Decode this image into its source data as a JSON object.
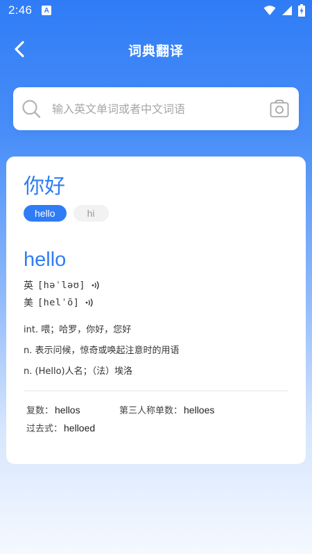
{
  "status_bar": {
    "time": "2:46",
    "notification_badge": "A",
    "icons": [
      "wifi-icon",
      "signal-icon",
      "battery-charging-icon"
    ]
  },
  "header": {
    "title": "词典翻译",
    "back_icon": "chevron-left-icon"
  },
  "search": {
    "placeholder": "输入英文单词或者中文词语",
    "value": "",
    "icon": "search-icon",
    "camera_icon": "camera-icon"
  },
  "result": {
    "query": "你好",
    "options": [
      {
        "label": "hello",
        "selected": true
      },
      {
        "label": "hi",
        "selected": false
      }
    ],
    "entry": {
      "word": "hello",
      "pronunciations": [
        {
          "lang": "英",
          "ipa": "[həˈləʊ]"
        },
        {
          "lang": "美",
          "ipa": "[helˈō]"
        }
      ],
      "definitions": [
        "int. 喂；哈罗，你好，您好",
        "n. 表示问候，惊奇或唤起注意时的用语",
        "n. (Hello)人名；（法）埃洛"
      ],
      "forms": [
        {
          "label": "复数：",
          "value": "hellos"
        },
        {
          "label": "第三人称单数：",
          "value": "helloes"
        },
        {
          "label": "过去式：",
          "value": "helloed"
        }
      ]
    }
  },
  "colors": {
    "primary": "#2f7cf6",
    "background_top": "#2f7cf6",
    "background_bottom": "#f5f9ff"
  }
}
